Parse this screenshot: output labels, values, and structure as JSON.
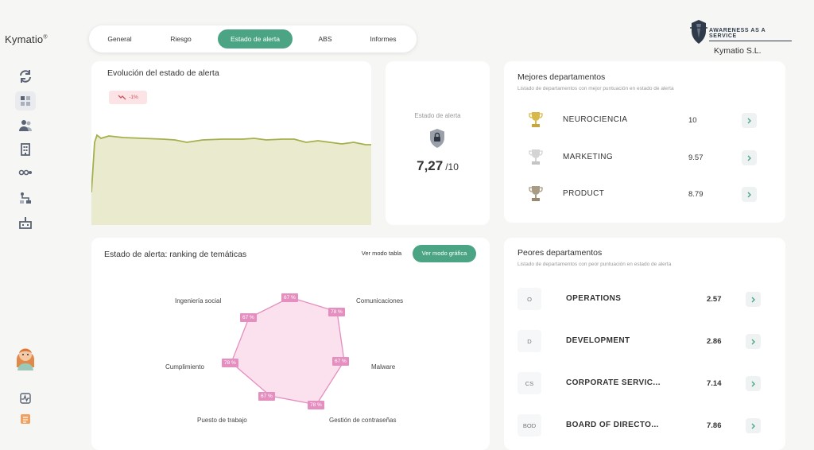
{
  "app": {
    "logo": "Kymatio",
    "logo_mark": "®"
  },
  "sidebar": {
    "icons": [
      "refresh-icon",
      "dashboard-icon",
      "users-icon",
      "building-icon",
      "settings-sliders-icon",
      "workflow-icon",
      "factory-icon"
    ],
    "bottom_icons": [
      "activity-icon",
      "document-icon"
    ]
  },
  "tabs": [
    {
      "label": "General",
      "active": false
    },
    {
      "label": "Riesgo",
      "active": false
    },
    {
      "label": "Estado de alerta",
      "active": true
    },
    {
      "label": "ABS",
      "active": false
    },
    {
      "label": "Informes",
      "active": false
    }
  ],
  "brand": {
    "tagline": "AWARENESS AS A SERVICE",
    "company": "Kymatio S.L."
  },
  "evolution": {
    "title": "Evolución del estado de alerta",
    "trend_badge": "-1%",
    "line_color": "#a5b04c",
    "fill_color": "#eaeacf"
  },
  "gauge": {
    "label": "Estado de alerta",
    "value": "7,27",
    "max": "/10"
  },
  "best": {
    "title": "Mejores departamentos",
    "subtitle": "Listado de departamentos con mejor puntuación en estado de alerta",
    "rows": [
      {
        "name": "NEUROCIENCIA",
        "score": "10",
        "trophy": "#d9b84a"
      },
      {
        "name": "MARKETING",
        "score": "9.57",
        "trophy": "#cfcfcf"
      },
      {
        "name": "PRODUCT",
        "score": "8.79",
        "trophy": "#a89c84"
      }
    ]
  },
  "ranking": {
    "title": "Estado de alerta: ranking de temáticas",
    "btn_table": "Ver modo tabla",
    "btn_chart": "Ver modo gráfica",
    "axes": [
      {
        "label": "Comunicaciones",
        "value": "78 %"
      },
      {
        "label": "Malware",
        "value": "67 %"
      },
      {
        "label": "Gestión de contraseñas",
        "value": "78 %"
      },
      {
        "label": "Puesto de trabajo",
        "value": "67 %"
      },
      {
        "label": "Cumplimiento",
        "value": "78 %"
      },
      {
        "label": "Ingeniería social",
        "value": "67 %"
      },
      {
        "label": "",
        "value": "67 %"
      }
    ]
  },
  "worst": {
    "title": "Peores departamentos",
    "subtitle": "Listado de departamentos con peor puntuación en estado de alerta",
    "rows": [
      {
        "initial": "O",
        "name": "OPERATIONS",
        "score": "2.57"
      },
      {
        "initial": "D",
        "name": "DEVELOPMENT",
        "score": "2.86"
      },
      {
        "initial": "CS",
        "name": "CORPORATE SERVIC...",
        "score": "7.14"
      },
      {
        "initial": "BOD",
        "name": "BOARD OF DIRECTO...",
        "score": "7.86"
      }
    ]
  },
  "colors": {
    "accent": "#4ba584",
    "radar": "#e48fc0",
    "radar_fill": "#fbe0ee"
  }
}
